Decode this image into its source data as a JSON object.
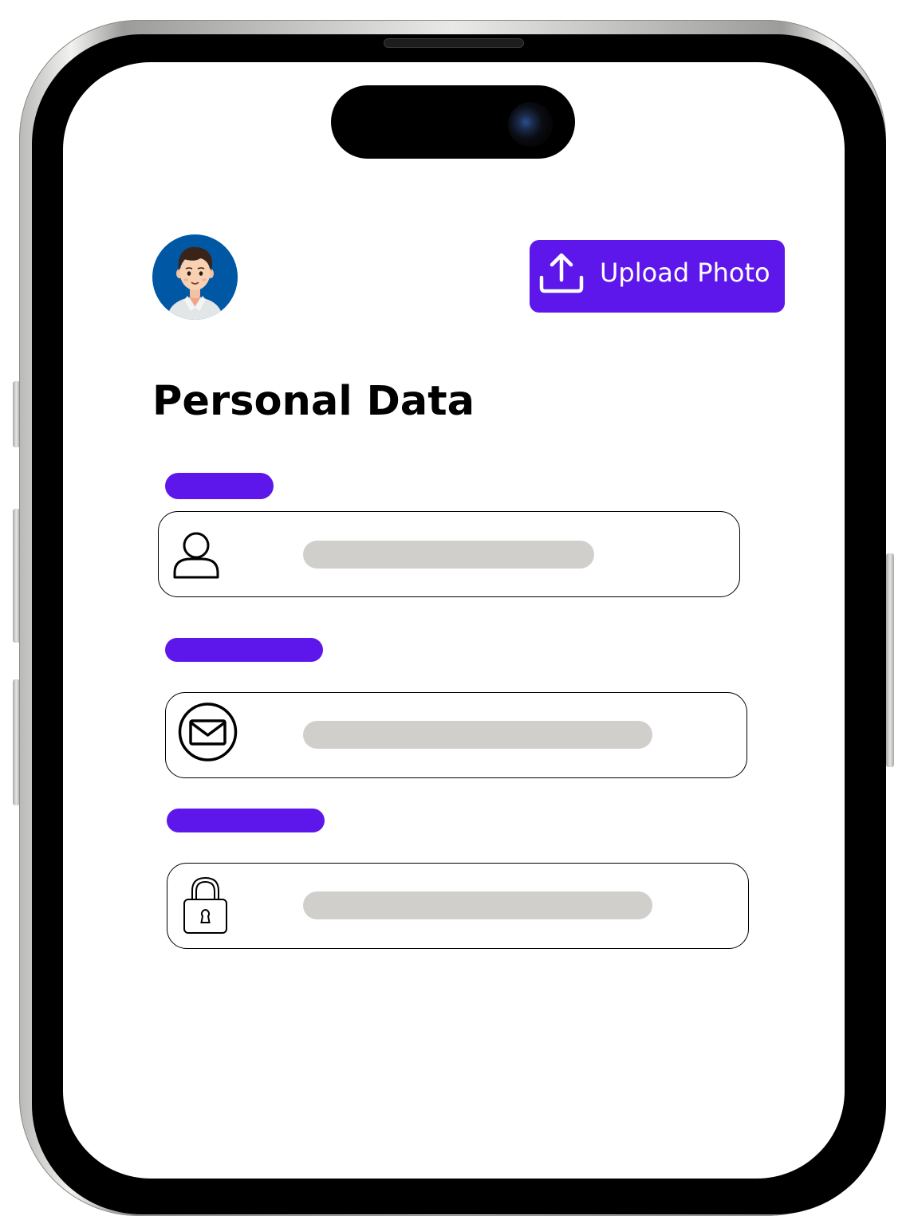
{
  "header": {
    "avatar": {
      "icon": "user-avatar-icon",
      "background": "#0057a3"
    },
    "upload_button": {
      "label": "Upload Photo",
      "icon": "upload-icon"
    }
  },
  "main": {
    "title": "Personal Data",
    "fields": [
      {
        "icon": "user-icon",
        "value": ""
      },
      {
        "icon": "mail-icon",
        "value": ""
      },
      {
        "icon": "lock-icon",
        "value": ""
      }
    ]
  },
  "colors": {
    "accent": "#5e17eb",
    "placeholder_bar": "#d0cfcb",
    "text": "#000000"
  }
}
